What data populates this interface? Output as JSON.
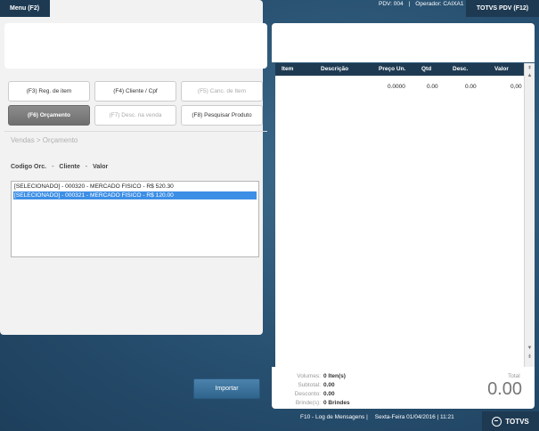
{
  "topbar": {
    "menu_label": "Menu (F2)",
    "pdv_info": "PDV: 004",
    "separator": "|",
    "operator_info": "Operador: CAIXA1",
    "app_label": "TOTVS PDV (F12)"
  },
  "fkeys": [
    {
      "label": "(F3) Reg. de item",
      "state": "normal"
    },
    {
      "label": "(F4) Cliente / Cpf",
      "state": "normal"
    },
    {
      "label": "(F5) Canc. de Item",
      "state": "disabled"
    },
    {
      "label": "(F6) Orçamento",
      "state": "active"
    },
    {
      "label": "(F7) Desc. na venda",
      "state": "disabled"
    },
    {
      "label": "(F8) Pesquisar Produto",
      "state": "normal"
    }
  ],
  "breadcrumb": "Vendas > Orçamento",
  "columns": {
    "code": "Codigo Orc.",
    "dash1": "-",
    "client": "Cliente",
    "dash2": "-",
    "value": "Valor"
  },
  "list": [
    {
      "text": "[SELECIONADO] - 000320 - MERCADO FISICO - R$ 520.30",
      "selected": false
    },
    {
      "text": "[SELECIONADO] - 000321 - MERCADO FISICO - R$ 120.00",
      "selected": true
    }
  ],
  "import_label": "Importar",
  "table": {
    "headers": [
      "Item",
      "Descrição",
      "Preço Un.",
      "Qtd",
      "Desc.",
      "Valor"
    ],
    "row": [
      "",
      "",
      "0.0000",
      "0.00",
      "0.00",
      "0,00"
    ]
  },
  "totals": {
    "volumes_label": "Volumes:",
    "volumes_value": "0 Iten(s)",
    "subtotal_label": "Subtotal:",
    "subtotal_value": "0.00",
    "desconto_label": "Desconto:",
    "desconto_value": "0.00",
    "brindes_label": "Brinde(s):",
    "brindes_value": "0 Brindes",
    "total_label": "Total",
    "total_value": "0.00"
  },
  "statusbar": {
    "log_label": "F10 - Log de Mensagens |",
    "datetime": "Sexta-Feira 01/04/2016 | 11:21",
    "brand": "TOTVS"
  },
  "colors": {
    "dark_navy": "#1e3a52",
    "selected_blue": "#3d8fe6",
    "import_blue": "#2f648c"
  }
}
